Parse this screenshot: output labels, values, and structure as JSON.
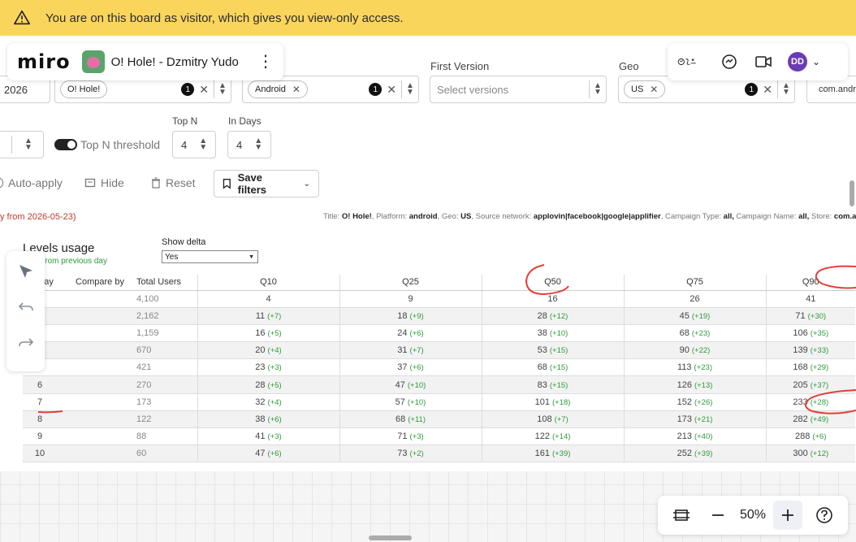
{
  "banner": {
    "text": "You are on this board as visitor, which gives you view-only access."
  },
  "miro": {
    "logo": "miro",
    "board_title": "O! Hole! - Dzmitry Yudo",
    "user_initials": "DD"
  },
  "filters": {
    "year_value": "2026",
    "app_chip": "O! Hole!",
    "app_count": "1",
    "platform_chip": "Android",
    "platform_count": "1",
    "first_version_label": "First Version",
    "first_version_placeholder": "Select versions",
    "geo_label": "Geo",
    "geo_chip": "US",
    "geo_count": "1",
    "store_chip": "com.andr",
    "top_n_threshold_label": "Top N threshold",
    "top_n_label": "Top N",
    "top_n_value": "4",
    "in_days_label": "In Days",
    "in_days_value": "4"
  },
  "actions": {
    "auto_apply": "Auto-apply",
    "hide": "Hide",
    "reset": "Reset",
    "save_filters": "Save filters"
  },
  "report": {
    "note": "y from 2026-05-23)",
    "title_line": {
      "t_label": "Title:",
      "t_val": "O! Hole!",
      "p_label": ", Platform:",
      "p_val": "android",
      "g_label": ", Geo:",
      "g_val": "US",
      "s_label": ", Source network:",
      "s_val": "applovin|facebook|google|applifier",
      "c_label": ", Campaign Type:",
      "c_val": "all,",
      "n_label": " Campaign Name:",
      "n_val": "all,",
      "st_label": " Store:",
      "st_val": "com.a"
    },
    "levels_title": "Levels usage",
    "levels_sub": "delta from previous day",
    "show_delta_label": "Show delta",
    "show_delta_value": "Yes"
  },
  "table": {
    "headers": [
      "tive day",
      "Compare by",
      "Total Users",
      "Q10",
      "Q25",
      "Q50",
      "Q75",
      "Q90"
    ],
    "rows": [
      {
        "day": "1",
        "total": "4,100",
        "q10": "4",
        "q10d": "",
        "q25": "9",
        "q25d": "",
        "q50": "16",
        "q50d": "",
        "q75": "26",
        "q75d": "",
        "q90": "41",
        "q90d": ""
      },
      {
        "day": "2",
        "total": "2,162",
        "q10": "11",
        "q10d": "(+7)",
        "q25": "18",
        "q25d": "(+9)",
        "q50": "28",
        "q50d": "(+12)",
        "q75": "45",
        "q75d": "(+19)",
        "q90": "71",
        "q90d": "(+30)"
      },
      {
        "day": "3",
        "total": "1,159",
        "q10": "16",
        "q10d": "(+5)",
        "q25": "24",
        "q25d": "(+6)",
        "q50": "38",
        "q50d": "(+10)",
        "q75": "68",
        "q75d": "(+23)",
        "q90": "106",
        "q90d": "(+35)"
      },
      {
        "day": "4",
        "total": "670",
        "q10": "20",
        "q10d": "(+4)",
        "q25": "31",
        "q25d": "(+7)",
        "q50": "53",
        "q50d": "(+15)",
        "q75": "90",
        "q75d": "(+22)",
        "q90": "139",
        "q90d": "(+33)"
      },
      {
        "day": "5",
        "total": "421",
        "q10": "23",
        "q10d": "(+3)",
        "q25": "37",
        "q25d": "(+6)",
        "q50": "68",
        "q50d": "(+15)",
        "q75": "113",
        "q75d": "(+23)",
        "q90": "168",
        "q90d": "(+29)"
      },
      {
        "day": "6",
        "total": "270",
        "q10": "28",
        "q10d": "(+5)",
        "q25": "47",
        "q25d": "(+10)",
        "q50": "83",
        "q50d": "(+15)",
        "q75": "126",
        "q75d": "(+13)",
        "q90": "205",
        "q90d": "(+37)"
      },
      {
        "day": "7",
        "total": "173",
        "q10": "32",
        "q10d": "(+4)",
        "q25": "57",
        "q25d": "(+10)",
        "q50": "101",
        "q50d": "(+18)",
        "q75": "152",
        "q75d": "(+26)",
        "q90": "233",
        "q90d": "(+28)"
      },
      {
        "day": "8",
        "total": "122",
        "q10": "38",
        "q10d": "(+6)",
        "q25": "68",
        "q25d": "(+11)",
        "q50": "108",
        "q50d": "(+7)",
        "q75": "173",
        "q75d": "(+21)",
        "q90": "282",
        "q90d": "(+49)"
      },
      {
        "day": "9",
        "total": "88",
        "q10": "41",
        "q10d": "(+3)",
        "q25": "71",
        "q25d": "(+3)",
        "q50": "122",
        "q50d": "(+14)",
        "q75": "213",
        "q75d": "(+40)",
        "q90": "288",
        "q90d": "(+6)"
      },
      {
        "day": "10",
        "total": "60",
        "q10": "47",
        "q10d": "(+6)",
        "q25": "73",
        "q25d": "(+2)",
        "q50": "161",
        "q50d": "(+39)",
        "q75": "252",
        "q75d": "(+39)",
        "q90": "300",
        "q90d": "(+12)"
      }
    ]
  },
  "zoom": {
    "level": "50%"
  },
  "colors": {
    "banner": "#fad55c",
    "delta_green": "#2e9a3b",
    "ink_red": "#e0403a",
    "avatar": "#6b3bb5"
  }
}
